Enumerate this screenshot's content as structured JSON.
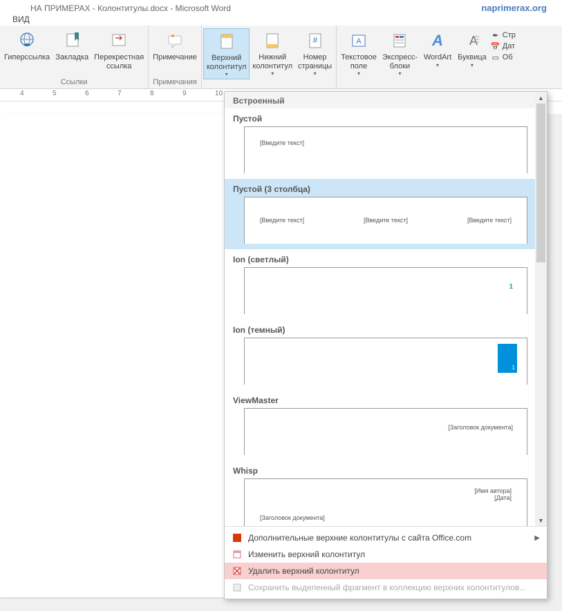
{
  "title": "НА ПРИМЕРАХ - Колонтитулы.docx - Microsoft Word",
  "site": "naprimerax.org",
  "tab": "ВИД",
  "ribbon": {
    "hyperlink": "Гиперссылка",
    "bookmark": "Закладка",
    "crossref": "Перекрестная\nссылка",
    "links_group": "Ссылки",
    "comment": "Примечание",
    "comments_group": "Примечания",
    "header": "Верхний\nколонтитул",
    "footer": "Нижний\nколонтитул",
    "pagenum": "Номер\nстраницы",
    "textbox": "Текстовое\nполе",
    "quickparts": "Экспресс-\nблоки",
    "wordart": "WordArt",
    "dropcap": "Буквица",
    "sig": "Стр",
    "date": "Дат",
    "object": "Об"
  },
  "ruler": [
    "4",
    "5",
    "6",
    "7",
    "8",
    "9",
    "10"
  ],
  "gallery": {
    "section": "Встроенный",
    "items": [
      {
        "title": "Пустой",
        "ph": [
          "[Введите текст]"
        ]
      },
      {
        "title": "Пустой (3 столбца)",
        "ph": [
          "[Введите текст]",
          "[Введите текст]",
          "[Введите текст]"
        ]
      },
      {
        "title": "Ion (светлый)",
        "num": "1"
      },
      {
        "title": "Ion (темный)",
        "num": "1"
      },
      {
        "title": "ViewMaster",
        "right": "[Заголовок документа]"
      },
      {
        "title": "Whisp",
        "left": "[Заголовок документа]",
        "r1": "[Имя автора]",
        "r2": "[Дата]"
      }
    ],
    "footer": {
      "more": "Дополнительные верхние колонтитулы с сайта Office.com",
      "edit": "Изменить верхний колонтитул",
      "remove": "Удалить верхний колонтитул",
      "save": "Сохранить выделенный фрагмент в коллекцию верхних колонтитулов..."
    }
  }
}
